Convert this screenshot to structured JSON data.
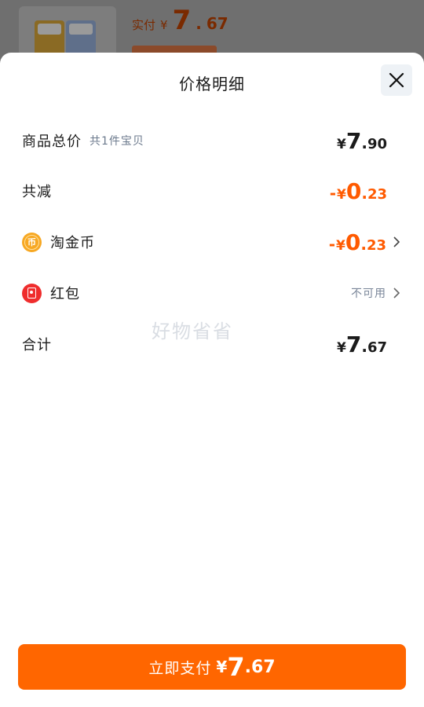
{
  "background": {
    "paid_label": "实付",
    "currency": "¥",
    "paid_int": "7",
    "paid_dot": ".",
    "paid_dec": "67"
  },
  "sheet": {
    "title": "价格明细",
    "close_icon": "close-icon"
  },
  "rows": {
    "goods_total": {
      "label": "商品总价",
      "sub": "共1件宝贝",
      "currency": "¥",
      "int": "7",
      "dot": ".",
      "dec": "90"
    },
    "total_discount": {
      "label": "共减",
      "sign": "-",
      "currency": "¥",
      "int": "0",
      "dot": ".",
      "dec": "23"
    },
    "taojinbi": {
      "label": "淘金币",
      "icon": "coin-icon",
      "coin_glyph": "币",
      "sign": "-",
      "currency": "¥",
      "int": "0",
      "dot": ".",
      "dec": "23"
    },
    "red_packet": {
      "label": "红包",
      "icon": "red-packet-icon",
      "status": "不可用"
    },
    "sum": {
      "label": "合计",
      "currency": "¥",
      "int": "7",
      "dot": ".",
      "dec": "67"
    }
  },
  "watermark": "好物省省",
  "pay_button": {
    "label": "立即支付",
    "currency": "¥",
    "int": "7",
    "dot": ".",
    "dec": "67"
  },
  "colors": {
    "accent": "#ff6600",
    "discount": "#ff5a00",
    "coin": "#f7a823",
    "red_packet": "#ef2d2d"
  }
}
